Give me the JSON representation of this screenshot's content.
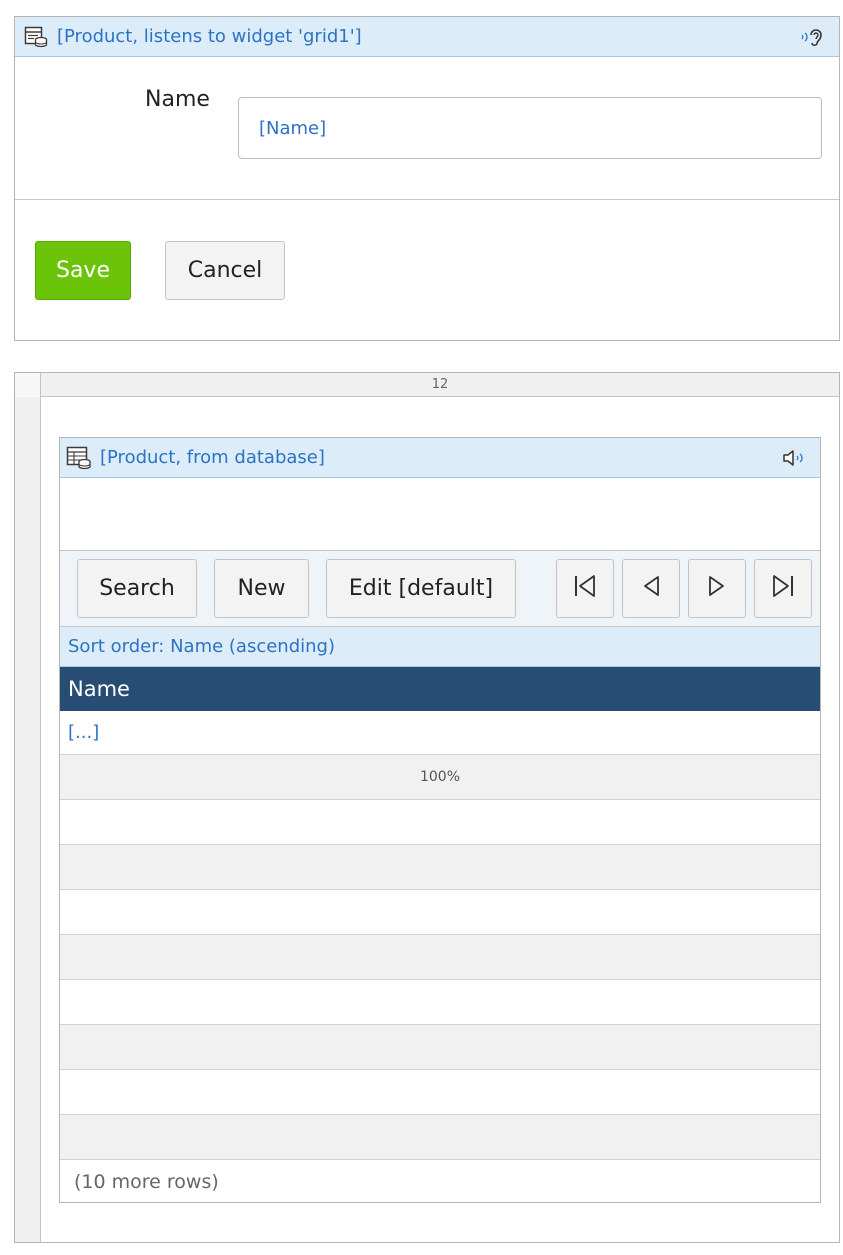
{
  "dataview": {
    "title": "[Product, listens to widget 'grid1']",
    "field_label": "Name",
    "field_value": "[Name]",
    "save_label": "Save",
    "cancel_label": "Cancel",
    "save_color": "#6bc30a"
  },
  "layout": {
    "column_width": "12"
  },
  "grid": {
    "title": "[Product, from database]",
    "toolbar": {
      "search_label": "Search",
      "new_label": "New",
      "edit_label": "Edit [default]",
      "nav_icons": [
        "first-page-icon",
        "previous-page-icon",
        "next-page-icon",
        "last-page-icon"
      ]
    },
    "sort_order": "Sort order: Name (ascending)",
    "columns": [
      "Name"
    ],
    "first_row_value": "[...]",
    "column_width_label": "100%",
    "more_rows": "(10 more rows)",
    "header_color": "#284d74"
  }
}
